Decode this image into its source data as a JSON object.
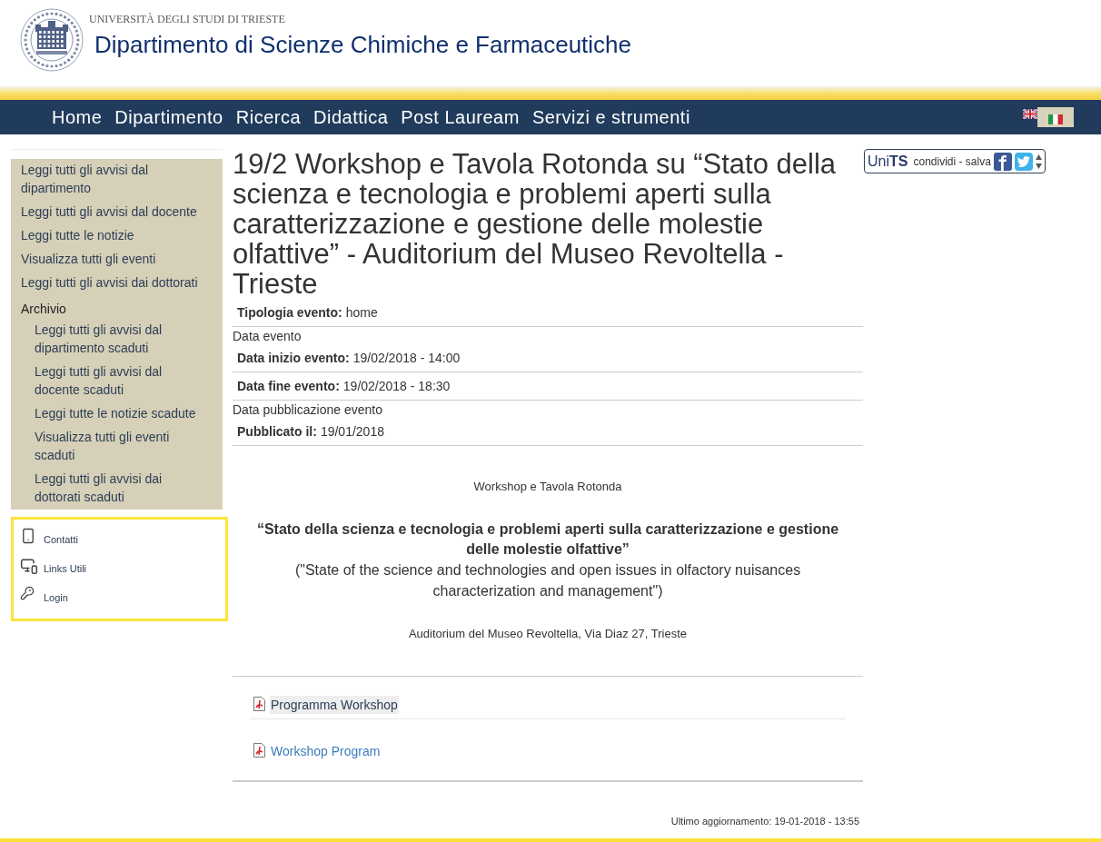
{
  "header": {
    "university": "UNIVERSITÀ DEGLI STUDI DI TRIESTE",
    "department": "Dipartimento di Scienze Chimiche e Farmaceutiche"
  },
  "nav": {
    "items": [
      "Home",
      "Dipartimento",
      "Ricerca",
      "Didattica",
      "Post Lauream",
      "Servizi e strumenti"
    ],
    "languages": [
      {
        "kind": "english",
        "selected": false
      },
      {
        "kind": "italian",
        "selected": true
      }
    ]
  },
  "sidebar": {
    "items": [
      {
        "label": "Leggi tutti gli avvisi dal dipartimento"
      },
      {
        "label": "Leggi tutti gli avvisi dal docente"
      },
      {
        "label": "Leggi tutte le notizie"
      },
      {
        "label": "Visualizza tutti gli eventi"
      },
      {
        "label": "Leggi tutti gli avvisi dai dottorati"
      },
      {
        "label": "Archivio",
        "children": [
          {
            "label": "Leggi tutti gli avvisi dal dipartimento scaduti"
          },
          {
            "label": "Leggi tutti gli avvisi dal docente scaduti"
          },
          {
            "label": "Leggi tutte le notizie scadute"
          },
          {
            "label": "Visualizza tutti gli eventi scaduti"
          },
          {
            "label": "Leggi tutti gli avvisi dai dottorati scaduti"
          }
        ]
      }
    ]
  },
  "quick_links": [
    {
      "kind": "contacts",
      "label": "Contatti"
    },
    {
      "kind": "links",
      "label": "Links Utili"
    },
    {
      "kind": "login",
      "label": "Login"
    }
  ],
  "event": {
    "title": "19/2 Workshop e Tavola Rotonda su “Stato della scienza e tecnologia e problemi aperti sulla caratterizzazione e gestione delle molestie olfattive” - Auditorium del Museo Revoltella - Trieste",
    "fields": [
      {
        "kind": "field",
        "label": "Tipologia evento:",
        "value": "home"
      },
      {
        "kind": "group",
        "label": "Data evento"
      },
      {
        "kind": "field",
        "label": "Data inizio evento:",
        "value": "19/02/2018 - 14:00"
      },
      {
        "kind": "field",
        "label": "Data fine evento:",
        "value": "19/02/2018 - 18:30"
      },
      {
        "kind": "group",
        "label": "Data pubblicazione evento"
      },
      {
        "kind": "field",
        "label": "Pubblicato il:",
        "value": "19/01/2018"
      }
    ],
    "body": {
      "intro": "Workshop e Tavola Rotonda",
      "heading": "“Stato della scienza e tecnologia e problemi aperti sulla caratterizzazione e gestione delle molestie olfattive”",
      "translation": "(\"State of the science and technologies and open issues in olfactory nuisances characterization and management\")",
      "venue": "Auditorium del Museo Revoltella, Via Diaz 27, Trieste"
    },
    "attachments": [
      {
        "label": "Programma Workshop",
        "highlighted": true
      },
      {
        "label": "Workshop Program",
        "highlighted": false
      }
    ]
  },
  "share": {
    "brand": "Uni**TS**",
    "label": "condividi - salva"
  },
  "footer": {
    "updated": "Ultimo aggiornamento: 19-01-2018 - 13:55"
  }
}
